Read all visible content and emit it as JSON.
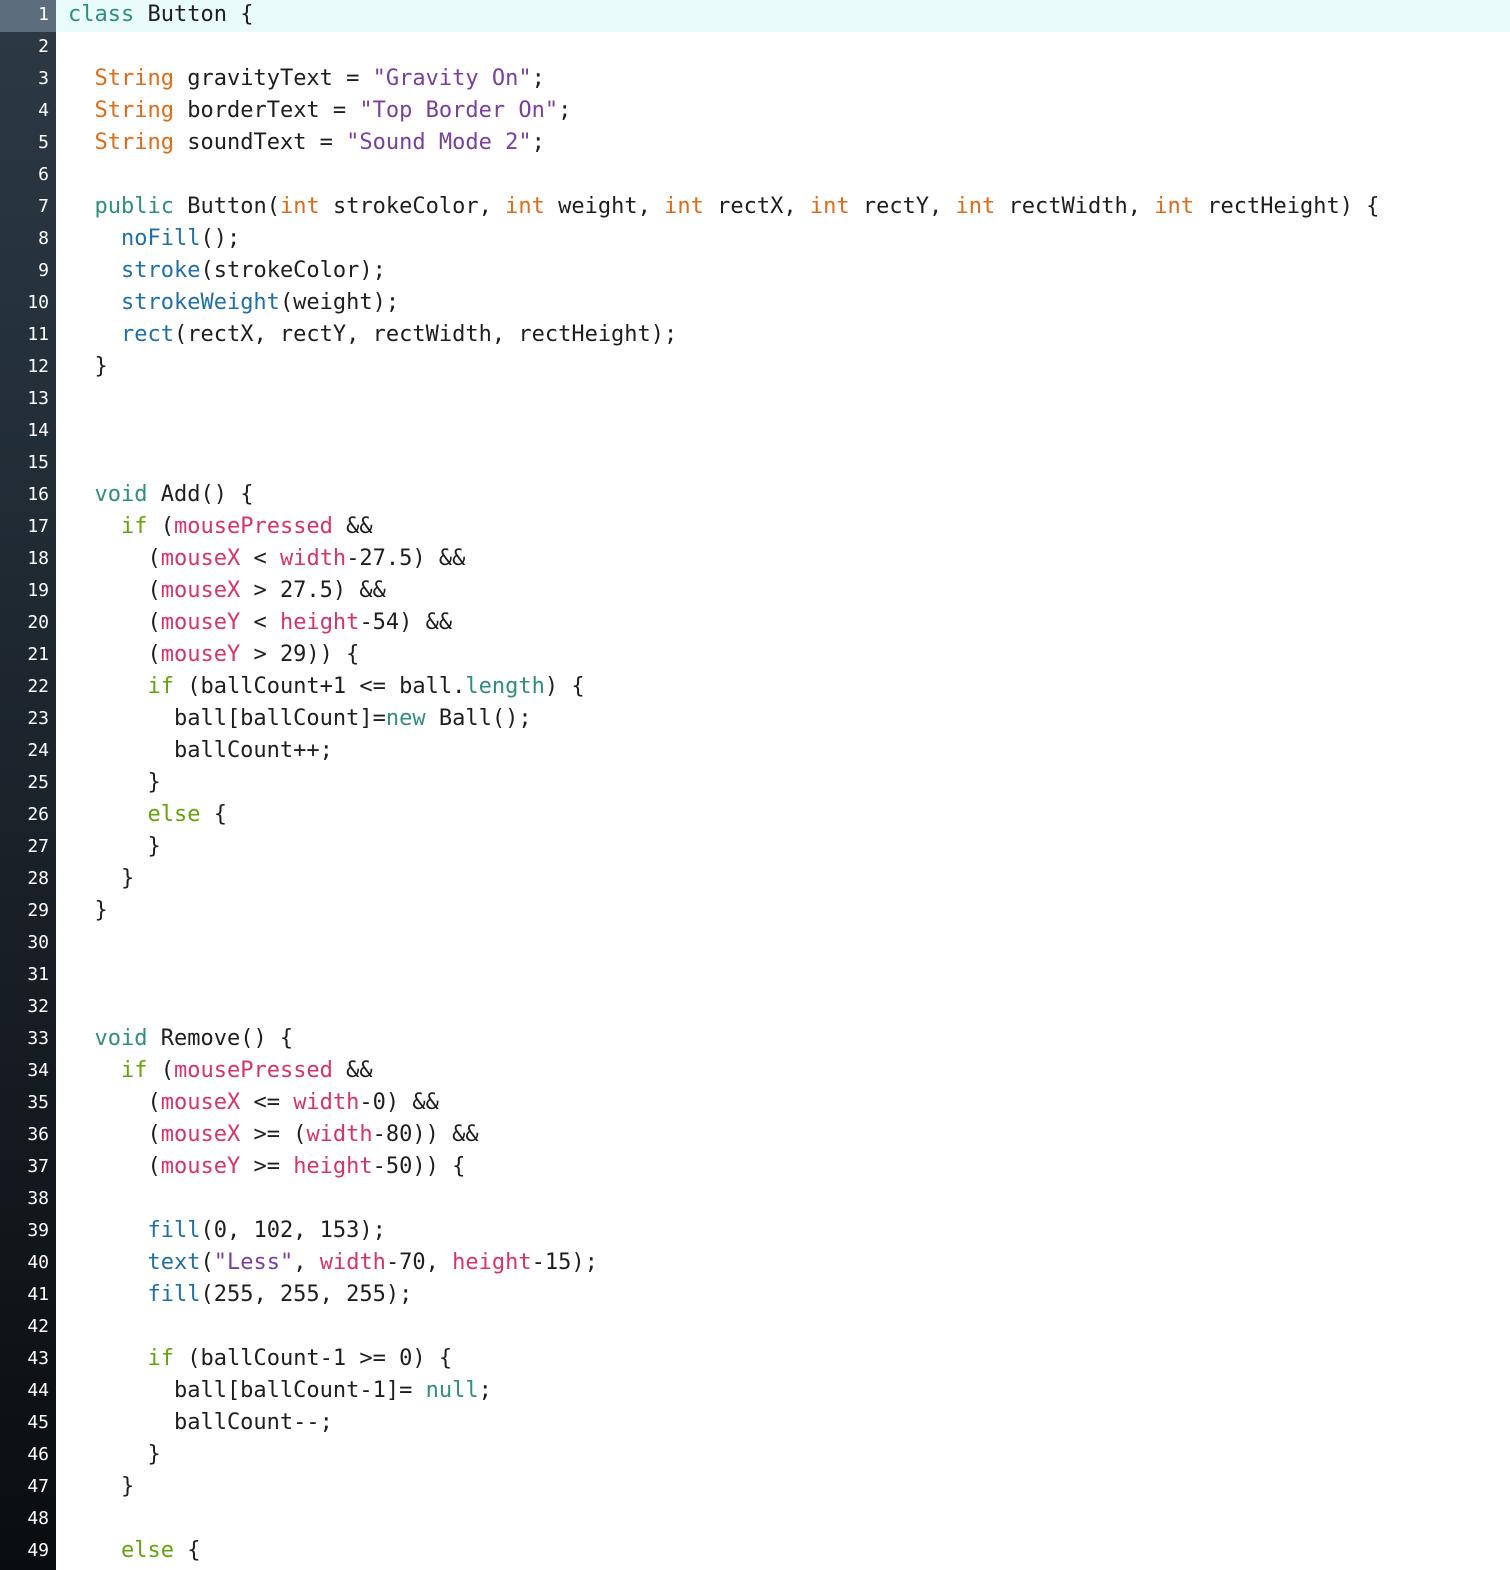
{
  "editor": {
    "current_line": 1,
    "lines": [
      [
        {
          "t": "class",
          "c": "kw"
        },
        {
          "t": " Button {"
        }
      ],
      [],
      [
        {
          "t": "  "
        },
        {
          "t": "String",
          "c": "ty"
        },
        {
          "t": " gravityText = "
        },
        {
          "t": "\"Gravity On\"",
          "c": "str"
        },
        {
          "t": ";"
        }
      ],
      [
        {
          "t": "  "
        },
        {
          "t": "String",
          "c": "ty"
        },
        {
          "t": " borderText = "
        },
        {
          "t": "\"Top Border On\"",
          "c": "str"
        },
        {
          "t": ";"
        }
      ],
      [
        {
          "t": "  "
        },
        {
          "t": "String",
          "c": "ty"
        },
        {
          "t": " soundText = "
        },
        {
          "t": "\"Sound Mode 2\"",
          "c": "str"
        },
        {
          "t": ";"
        }
      ],
      [],
      [
        {
          "t": "  "
        },
        {
          "t": "public",
          "c": "kw"
        },
        {
          "t": " Button("
        },
        {
          "t": "int",
          "c": "ty"
        },
        {
          "t": " strokeColor, "
        },
        {
          "t": "int",
          "c": "ty"
        },
        {
          "t": " weight, "
        },
        {
          "t": "int",
          "c": "ty"
        },
        {
          "t": " rectX, "
        },
        {
          "t": "int",
          "c": "ty"
        },
        {
          "t": " rectY, "
        },
        {
          "t": "int",
          "c": "ty"
        },
        {
          "t": " rectWidth, "
        },
        {
          "t": "int",
          "c": "ty"
        },
        {
          "t": " rectHeight) {"
        }
      ],
      [
        {
          "t": "    "
        },
        {
          "t": "noFill",
          "c": "fn"
        },
        {
          "t": "();"
        }
      ],
      [
        {
          "t": "    "
        },
        {
          "t": "stroke",
          "c": "fn"
        },
        {
          "t": "(strokeColor);"
        }
      ],
      [
        {
          "t": "    "
        },
        {
          "t": "strokeWeight",
          "c": "fn"
        },
        {
          "t": "(weight);"
        }
      ],
      [
        {
          "t": "    "
        },
        {
          "t": "rect",
          "c": "fn"
        },
        {
          "t": "(rectX, rectY, rectWidth, rectHeight);"
        }
      ],
      [
        {
          "t": "  }"
        }
      ],
      [],
      [],
      [],
      [
        {
          "t": "  "
        },
        {
          "t": "void",
          "c": "kw"
        },
        {
          "t": " Add() {"
        }
      ],
      [
        {
          "t": "    "
        },
        {
          "t": "if",
          "c": "ctl"
        },
        {
          "t": " ("
        },
        {
          "t": "mousePressed",
          "c": "bi"
        },
        {
          "t": " &&"
        }
      ],
      [
        {
          "t": "      ("
        },
        {
          "t": "mouseX",
          "c": "bi"
        },
        {
          "t": " < "
        },
        {
          "t": "width",
          "c": "bi"
        },
        {
          "t": "-27.5) &&"
        }
      ],
      [
        {
          "t": "      ("
        },
        {
          "t": "mouseX",
          "c": "bi"
        },
        {
          "t": " > 27.5) &&"
        }
      ],
      [
        {
          "t": "      ("
        },
        {
          "t": "mouseY",
          "c": "bi"
        },
        {
          "t": " < "
        },
        {
          "t": "height",
          "c": "bi"
        },
        {
          "t": "-54) &&"
        }
      ],
      [
        {
          "t": "      ("
        },
        {
          "t": "mouseY",
          "c": "bi"
        },
        {
          "t": " > 29)) {"
        }
      ],
      [
        {
          "t": "      "
        },
        {
          "t": "if",
          "c": "ctl"
        },
        {
          "t": " (ballCount+1 <= ball."
        },
        {
          "t": "length",
          "c": "kw"
        },
        {
          "t": ") {"
        }
      ],
      [
        {
          "t": "        ball[ballCount]="
        },
        {
          "t": "new",
          "c": "kw"
        },
        {
          "t": " Ball();"
        }
      ],
      [
        {
          "t": "        ballCount++;"
        }
      ],
      [
        {
          "t": "      }"
        }
      ],
      [
        {
          "t": "      "
        },
        {
          "t": "else",
          "c": "ctl"
        },
        {
          "t": " {"
        }
      ],
      [
        {
          "t": "      }"
        }
      ],
      [
        {
          "t": "    }"
        }
      ],
      [
        {
          "t": "  }"
        }
      ],
      [],
      [],
      [],
      [
        {
          "t": "  "
        },
        {
          "t": "void",
          "c": "kw"
        },
        {
          "t": " Remove() {"
        }
      ],
      [
        {
          "t": "    "
        },
        {
          "t": "if",
          "c": "ctl"
        },
        {
          "t": " ("
        },
        {
          "t": "mousePressed",
          "c": "bi"
        },
        {
          "t": " &&"
        }
      ],
      [
        {
          "t": "      ("
        },
        {
          "t": "mouseX",
          "c": "bi"
        },
        {
          "t": " <= "
        },
        {
          "t": "width",
          "c": "bi"
        },
        {
          "t": "-0) &&"
        }
      ],
      [
        {
          "t": "      ("
        },
        {
          "t": "mouseX",
          "c": "bi"
        },
        {
          "t": " >= ("
        },
        {
          "t": "width",
          "c": "bi"
        },
        {
          "t": "-80)) &&"
        }
      ],
      [
        {
          "t": "      ("
        },
        {
          "t": "mouseY",
          "c": "bi"
        },
        {
          "t": " >= "
        },
        {
          "t": "height",
          "c": "bi"
        },
        {
          "t": "-50)) {"
        }
      ],
      [],
      [
        {
          "t": "      "
        },
        {
          "t": "fill",
          "c": "fn"
        },
        {
          "t": "(0, 102, 153);"
        }
      ],
      [
        {
          "t": "      "
        },
        {
          "t": "text",
          "c": "fn"
        },
        {
          "t": "("
        },
        {
          "t": "\"Less\"",
          "c": "str"
        },
        {
          "t": ", "
        },
        {
          "t": "width",
          "c": "bi"
        },
        {
          "t": "-70, "
        },
        {
          "t": "height",
          "c": "bi"
        },
        {
          "t": "-15);"
        }
      ],
      [
        {
          "t": "      "
        },
        {
          "t": "fill",
          "c": "fn"
        },
        {
          "t": "(255, 255, 255);"
        }
      ],
      [],
      [
        {
          "t": "      "
        },
        {
          "t": "if",
          "c": "ctl"
        },
        {
          "t": " (ballCount-1 >= 0) {"
        }
      ],
      [
        {
          "t": "        ball[ballCount-1]= "
        },
        {
          "t": "null",
          "c": "kw"
        },
        {
          "t": ";"
        }
      ],
      [
        {
          "t": "        ballCount--;"
        }
      ],
      [
        {
          "t": "      }"
        }
      ],
      [
        {
          "t": "    }"
        }
      ],
      [],
      [
        {
          "t": "    "
        },
        {
          "t": "else",
          "c": "ctl"
        },
        {
          "t": " {"
        }
      ]
    ]
  }
}
